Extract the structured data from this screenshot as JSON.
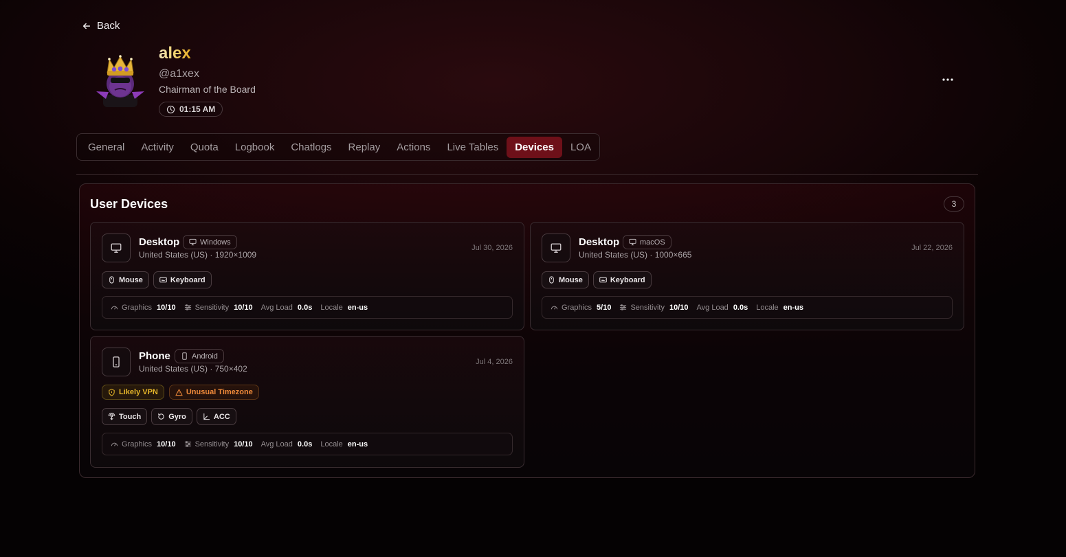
{
  "nav": {
    "back_label": "Back"
  },
  "profile": {
    "name": "alex",
    "handle": "@a1xex",
    "role": "Chairman of the Board",
    "local_time": "01:15 AM"
  },
  "tabs": [
    {
      "label": "General"
    },
    {
      "label": "Activity"
    },
    {
      "label": "Quota"
    },
    {
      "label": "Logbook"
    },
    {
      "label": "Chatlogs"
    },
    {
      "label": "Replay"
    },
    {
      "label": "Actions"
    },
    {
      "label": "Live Tables"
    },
    {
      "label": "Devices",
      "active": true
    },
    {
      "label": "LOA"
    }
  ],
  "devices_panel": {
    "title": "User Devices",
    "count": "3",
    "devices": [
      {
        "type": "Desktop",
        "device_icon": "monitor-icon",
        "os": "Windows",
        "location_resolution": "United States (US) · 1920×1009",
        "date": "Jul 30, 2026",
        "flags": [],
        "inputs": [
          {
            "label": "Mouse",
            "icon": "mouse-icon"
          },
          {
            "label": "Keyboard",
            "icon": "keyboard-icon"
          }
        ],
        "stats": {
          "graphics_label": "Graphics",
          "graphics": "10/10",
          "sensitivity_label": "Sensitivity",
          "sensitivity": "10/10",
          "avg_load_label": "Avg Load",
          "avg_load": "0.0s",
          "locale_label": "Locale",
          "locale": "en-us"
        }
      },
      {
        "type": "Desktop",
        "device_icon": "monitor-icon",
        "os": "macOS",
        "location_resolution": "United States (US) · 1000×665",
        "date": "Jul 22, 2026",
        "flags": [],
        "inputs": [
          {
            "label": "Mouse",
            "icon": "mouse-icon"
          },
          {
            "label": "Keyboard",
            "icon": "keyboard-icon"
          }
        ],
        "stats": {
          "graphics_label": "Graphics",
          "graphics": "5/10",
          "sensitivity_label": "Sensitivity",
          "sensitivity": "10/10",
          "avg_load_label": "Avg Load",
          "avg_load": "0.0s",
          "locale_label": "Locale",
          "locale": "en-us"
        }
      },
      {
        "type": "Phone",
        "device_icon": "smartphone-icon",
        "os": "Android",
        "location_resolution": "United States (US) · 750×402",
        "date": "Jul 4, 2026",
        "flags": [
          {
            "label": "Likely VPN",
            "icon": "shield-icon",
            "color": "#e5b52a"
          },
          {
            "label": "Unusual Timezone",
            "icon": "warning-icon",
            "color": "#ef8a3a"
          }
        ],
        "inputs": [
          {
            "label": "Touch",
            "icon": "touch-icon"
          },
          {
            "label": "Gyro",
            "icon": "rotate-icon"
          },
          {
            "label": "ACC",
            "icon": "axis-icon"
          }
        ],
        "stats": {
          "graphics_label": "Graphics",
          "graphics": "10/10",
          "sensitivity_label": "Sensitivity",
          "sensitivity": "10/10",
          "avg_load_label": "Avg Load",
          "avg_load": "0.0s",
          "locale_label": "Locale",
          "locale": "en-us"
        }
      }
    ]
  },
  "colors": {
    "accent_active_tab": "#6e1019",
    "name_gradient_start": "#f3e6b8",
    "name_gradient_end": "#e6a91f",
    "warning_yellow": "#e5b52a",
    "warning_orange": "#ef8a3a"
  }
}
